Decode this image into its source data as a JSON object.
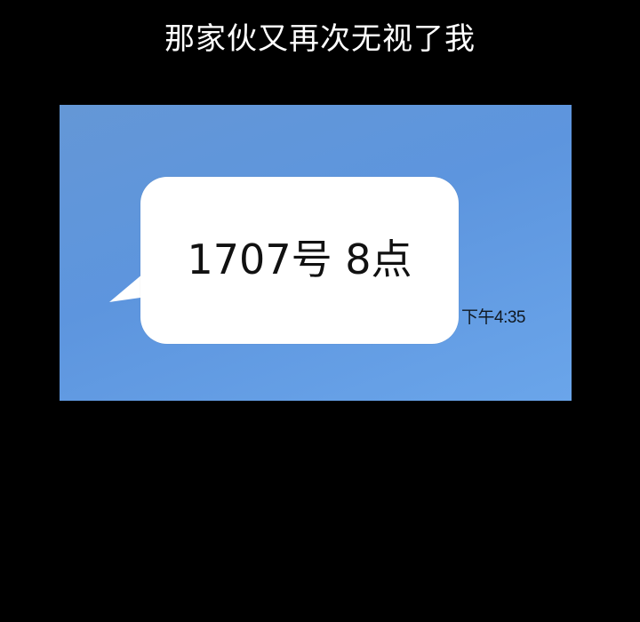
{
  "caption": "那家伙又再次无视了我",
  "message": {
    "text": "1707号 8点",
    "time": "下午4:35"
  },
  "colors": {
    "background": "#000000",
    "chat_background": "#6497d6",
    "bubble": "#ffffff"
  }
}
